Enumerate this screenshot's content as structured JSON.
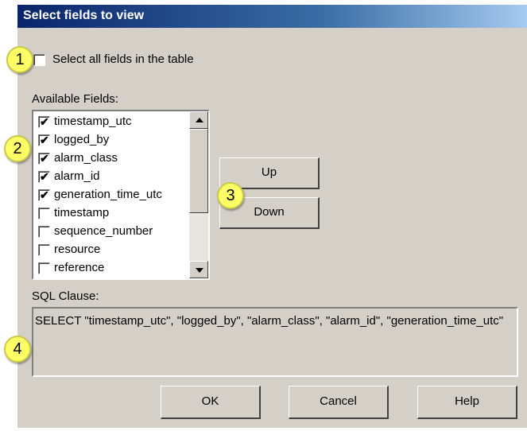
{
  "dialog": {
    "title": "Select fields to view"
  },
  "select_all": {
    "label": "Select all fields in the table",
    "checked": false
  },
  "available_fields": {
    "label": "Available Fields:",
    "items": [
      {
        "label": "timestamp_utc",
        "checked": true
      },
      {
        "label": "logged_by",
        "checked": true
      },
      {
        "label": "alarm_class",
        "checked": true
      },
      {
        "label": "alarm_id",
        "checked": true
      },
      {
        "label": "generation_time_utc",
        "checked": true
      },
      {
        "label": "timestamp",
        "checked": false
      },
      {
        "label": "sequence_number",
        "checked": false
      },
      {
        "label": "resource",
        "checked": false
      },
      {
        "label": "reference",
        "checked": false
      }
    ]
  },
  "buttons": {
    "up": "Up",
    "down": "Down",
    "ok": "OK",
    "cancel": "Cancel",
    "help": "Help"
  },
  "sql": {
    "label": "SQL Clause:",
    "text": "SELECT \"timestamp_utc\", \"logged_by\", \"alarm_class\", \"alarm_id\", \"generation_time_utc\""
  },
  "callouts": [
    "1",
    "2",
    "3",
    "4"
  ],
  "colors": {
    "titlebar_start": "#0a246a",
    "titlebar_end": "#a6caf0",
    "dialog_bg": "#d4d0c8",
    "callout": "#ffff66"
  }
}
